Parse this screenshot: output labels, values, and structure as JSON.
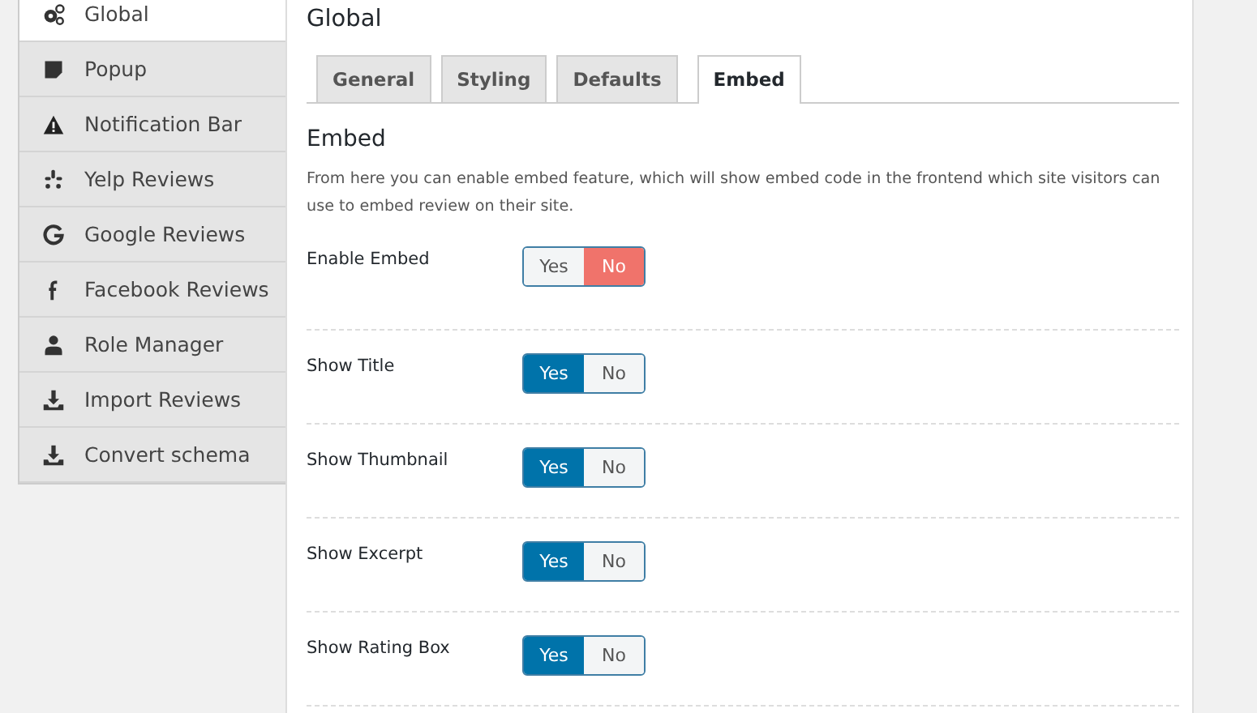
{
  "sidebar": {
    "items": [
      {
        "label": "Global",
        "kind": "gears",
        "selected": true
      },
      {
        "label": "Popup",
        "kind": "note",
        "selected": false
      },
      {
        "label": "Notification Bar",
        "kind": "warning",
        "selected": false
      },
      {
        "label": "Yelp Reviews",
        "kind": "yelp",
        "selected": false
      },
      {
        "label": "Google Reviews",
        "kind": "google",
        "selected": false
      },
      {
        "label": "Facebook Reviews",
        "kind": "facebook",
        "selected": false
      },
      {
        "label": "Role Manager",
        "kind": "user",
        "selected": false
      },
      {
        "label": "Import Reviews",
        "kind": "download",
        "selected": false
      },
      {
        "label": "Convert schema",
        "kind": "download",
        "selected": false
      }
    ]
  },
  "panel": {
    "title": "Global",
    "tabs": [
      {
        "label": "General",
        "selected": false
      },
      {
        "label": "Styling",
        "selected": false
      },
      {
        "label": "Defaults",
        "selected": false
      },
      {
        "label": "Embed",
        "selected": true
      }
    ],
    "section_title": "Embed",
    "description": "From here you can enable embed feature, which will show embed code in the frontend which site visitors can use to embed review on their site.",
    "settings": [
      {
        "label": "Enable Embed",
        "options": [
          {
            "label": "Yes",
            "kind": "yes",
            "selected": false
          },
          {
            "label": "No",
            "kind": "no",
            "selected": true
          }
        ]
      },
      {
        "label": "Show Title",
        "options": [
          {
            "label": "Yes",
            "kind": "yes",
            "selected": true
          },
          {
            "label": "No",
            "kind": "no",
            "selected": false
          }
        ]
      },
      {
        "label": "Show Thumbnail",
        "options": [
          {
            "label": "Yes",
            "kind": "yes",
            "selected": true
          },
          {
            "label": "No",
            "kind": "no",
            "selected": false
          }
        ]
      },
      {
        "label": "Show Excerpt",
        "options": [
          {
            "label": "Yes",
            "kind": "yes",
            "selected": true
          },
          {
            "label": "No",
            "kind": "no",
            "selected": false
          }
        ]
      },
      {
        "label": "Show Rating Box",
        "options": [
          {
            "label": "Yes",
            "kind": "yes",
            "selected": true
          },
          {
            "label": "No",
            "kind": "no",
            "selected": false
          }
        ]
      }
    ]
  }
}
